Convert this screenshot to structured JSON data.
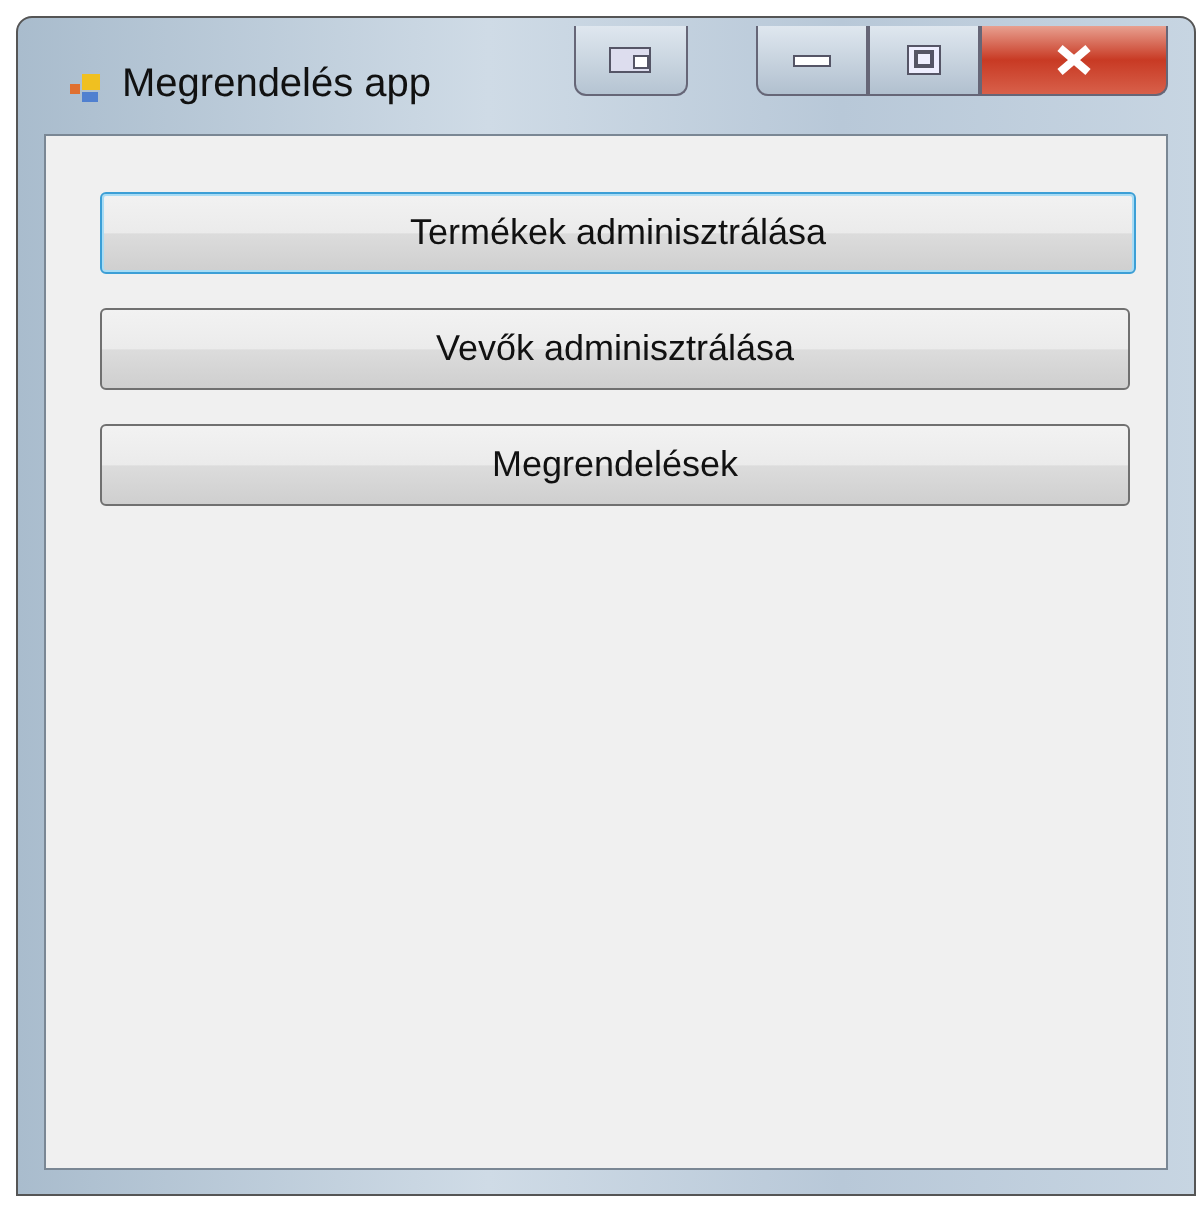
{
  "window": {
    "title": "Megrendelés app"
  },
  "buttons": [
    {
      "label": "Termékek adminisztrálása",
      "focused": true
    },
    {
      "label": "Vevők adminisztrálása",
      "focused": false
    },
    {
      "label": "Megrendelések",
      "focused": false
    }
  ]
}
